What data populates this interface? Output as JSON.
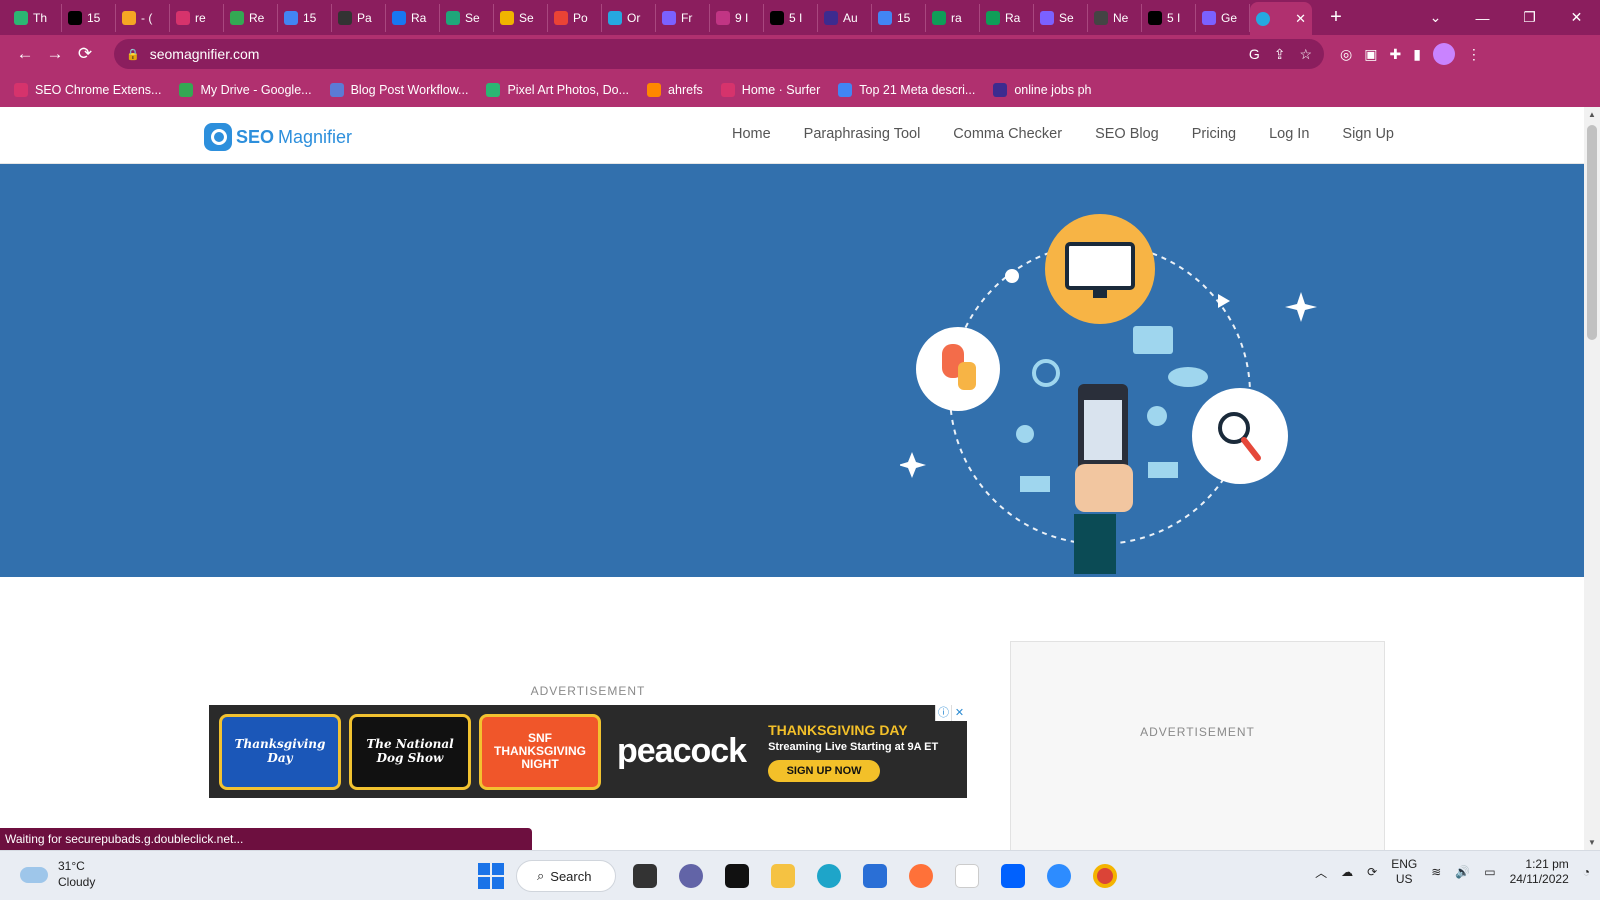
{
  "browser": {
    "tabs": [
      {
        "label": "Th",
        "color": "#2bb673"
      },
      {
        "label": "15",
        "color": "#000000"
      },
      {
        "label": "- (",
        "color": "#f5a623"
      },
      {
        "label": "re",
        "color": "#d6336c"
      },
      {
        "label": "Re",
        "color": "#34a853"
      },
      {
        "label": "15",
        "color": "#4285f4"
      },
      {
        "label": "Pa",
        "color": "#333333"
      },
      {
        "label": "Ra",
        "color": "#1877f2"
      },
      {
        "label": "Se",
        "color": "#1fa67a"
      },
      {
        "label": "Se",
        "color": "#f0b400"
      },
      {
        "label": "Po",
        "color": "#ea4335"
      },
      {
        "label": "Or",
        "color": "#26a8e0"
      },
      {
        "label": "Fr",
        "color": "#7b61ff"
      },
      {
        "label": "9 I",
        "color": "#c13584"
      },
      {
        "label": "5 I",
        "color": "#000000"
      },
      {
        "label": "Au",
        "color": "#3d2b8f"
      },
      {
        "label": "15",
        "color": "#4285f4"
      },
      {
        "label": "ra",
        "color": "#0f9d58"
      },
      {
        "label": "Ra",
        "color": "#0f9d58"
      },
      {
        "label": "Se",
        "color": "#7b61ff"
      },
      {
        "label": "Ne",
        "color": "#444444"
      },
      {
        "label": "5 I",
        "color": "#000000"
      },
      {
        "label": "Ge",
        "color": "#7b61ff"
      }
    ],
    "active_tab": {
      "label": "",
      "close": "✕"
    },
    "new_tab": "+",
    "window_controls": {
      "dropdown": "⌄",
      "minimize": "—",
      "restore": "❐",
      "close": "✕"
    },
    "url": "seomagnifier.com",
    "bookmarks": [
      {
        "label": "SEO Chrome Extens...",
        "color": "#d6336c"
      },
      {
        "label": "My Drive - Google...",
        "color": "#34a853"
      },
      {
        "label": "Blog Post Workflow...",
        "color": "#5b7bd5"
      },
      {
        "label": "Pixel Art Photos, Do...",
        "color": "#2bb673"
      },
      {
        "label": "ahrefs",
        "color": "#ff8800"
      },
      {
        "label": "Home · Surfer",
        "color": "#d6336c"
      },
      {
        "label": "Top 21 Meta descri...",
        "color": "#4285f4"
      },
      {
        "label": "online jobs ph",
        "color": "#3d2b8f"
      }
    ]
  },
  "site": {
    "logo_seo": "SEO",
    "logo_magnifier": "Magnifier",
    "nav": [
      "Home",
      "Paraphrasing Tool",
      "Comma Checker",
      "SEO Blog",
      "Pricing",
      "Log In",
      "Sign Up"
    ],
    "advertisement_label": "ADVERTISEMENT",
    "sidebar_ad_label": "ADVERTISEMENT"
  },
  "ad": {
    "tile1": "Thanksgiving Day",
    "tile2": "The National Dog Show",
    "tile3": "SNF THANKSGIVING NIGHT",
    "brand": "peacock",
    "headline": "THANKSGIVING DAY",
    "subline": "Streaming Live Starting at 9A ET",
    "cta": "SIGN UP NOW"
  },
  "status": "Waiting for securepubads.g.doubleclick.net...",
  "taskbar": {
    "temperature": "31°C",
    "condition": "Cloudy",
    "search_label": "Search",
    "lang_top": "ENG",
    "lang_bottom": "US",
    "time": "1:21 pm",
    "date": "24/11/2022"
  },
  "colors": {
    "browser_frame": "#8b1e5e",
    "toolbar": "#b0306f",
    "hero": "#3270ad",
    "brand": "#2d8fdc"
  }
}
